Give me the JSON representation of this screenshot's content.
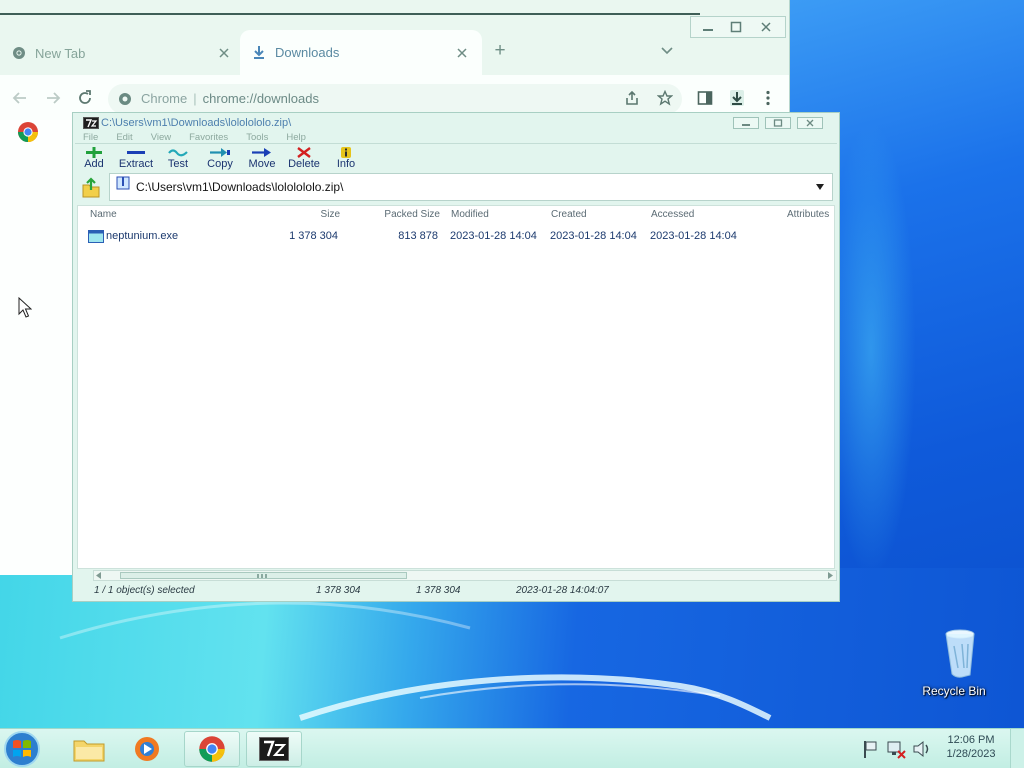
{
  "desktop": {
    "recycle_bin_label": "Recycle Bin",
    "accent_blue": "#1466e6",
    "accent_cyan": "#46d8e8",
    "icons": [
      "recycle-bin-icon"
    ]
  },
  "chrome": {
    "tabs": [
      {
        "label": "New Tab",
        "icon": "chrome-favicon-icon"
      },
      {
        "label": "Downloads",
        "icon": "download-icon"
      }
    ],
    "new_tab_button": "+",
    "omnibox": {
      "site_label": "Chrome",
      "separator": "|",
      "url": "chrome://downloads"
    },
    "toolbar_icons": [
      "back-icon",
      "forward-icon",
      "reload-icon",
      "share-icon",
      "star-icon",
      "side-panel-icon",
      "download-icon",
      "menu-icon"
    ]
  },
  "sevenzip": {
    "title": "C:\\Users\\vm1\\Downloads\\lololololo.zip\\",
    "menu": [
      "File",
      "Edit",
      "View",
      "Favorites",
      "Tools",
      "Help"
    ],
    "toolbar": [
      {
        "label": "Add",
        "icon": "add-icon",
        "color": "#21a13c"
      },
      {
        "label": "Extract",
        "icon": "extract-icon",
        "color": "#1a3fb5"
      },
      {
        "label": "Test",
        "icon": "test-icon",
        "color": "#23a9b8"
      },
      {
        "label": "Copy",
        "icon": "copy-icon",
        "color": "#1f8fb0"
      },
      {
        "label": "Move",
        "icon": "move-icon",
        "color": "#1a3fb5"
      },
      {
        "label": "Delete",
        "icon": "delete-icon",
        "color": "#d32020"
      },
      {
        "label": "Info",
        "icon": "info-icon",
        "color": "#e6c41a"
      }
    ],
    "path": "C:\\Users\\vm1\\Downloads\\lololololo.zip\\",
    "columns": {
      "name": "Name",
      "size": "Size",
      "packed": "Packed Size",
      "modified": "Modified",
      "created": "Created",
      "accessed": "Accessed",
      "attributes": "Attributes"
    },
    "rows": [
      {
        "name": "neptunium.exe",
        "size": "1 378 304",
        "packed": "813 878",
        "modified": "2023-01-28 14:04",
        "created": "2023-01-28 14:04",
        "accessed": "2023-01-28 14:04"
      }
    ],
    "status": {
      "selection": "1 / 1 object(s) selected",
      "size": "1 378 304",
      "packed": "1 378 304",
      "modified": "2023-01-28 14:04:07"
    }
  },
  "taskbar": {
    "pinned": [
      "windows-explorer-icon",
      "media-player-icon",
      "chrome-icon",
      "7zip-icon"
    ],
    "time": "12:06 PM",
    "date": "1/28/2023"
  }
}
